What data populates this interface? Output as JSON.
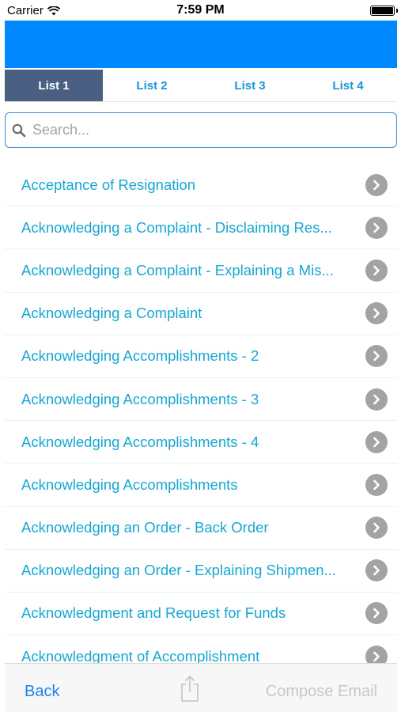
{
  "status_bar": {
    "carrier": "Carrier",
    "time": "7:59 PM",
    "battery_level": 1.0
  },
  "header": {
    "color": "#0088ff"
  },
  "tabs": [
    {
      "label": "List 1",
      "active": true
    },
    {
      "label": "List 2",
      "active": false
    },
    {
      "label": "List 3",
      "active": false
    },
    {
      "label": "List 4",
      "active": false
    }
  ],
  "search": {
    "placeholder": "Search...",
    "value": ""
  },
  "list": {
    "items": [
      {
        "label": "Acceptance of Resignation"
      },
      {
        "label": "Acknowledging a Complaint - Disclaiming Res..."
      },
      {
        "label": "Acknowledging a Complaint - Explaining a Mis..."
      },
      {
        "label": "Acknowledging a Complaint"
      },
      {
        "label": "Acknowledging Accomplishments - 2"
      },
      {
        "label": "Acknowledging Accomplishments - 3"
      },
      {
        "label": "Acknowledging Accomplishments - 4"
      },
      {
        "label": "Acknowledging Accomplishments"
      },
      {
        "label": "Acknowledging an Order - Back Order"
      },
      {
        "label": "Acknowledging an Order - Explaining Shipmen..."
      },
      {
        "label": "Acknowledgment and Request for Funds"
      },
      {
        "label": "Acknowledgment of Accomplishment"
      }
    ]
  },
  "toolbar": {
    "back_label": "Back",
    "share_icon": "share-icon",
    "compose_label": "Compose Email",
    "compose_enabled": false
  },
  "colors": {
    "accent": "#1a84e8",
    "tab_active_bg": "#4a5f82",
    "item_text": "#17a7d3",
    "chevron_bg": "#a3a3a3"
  }
}
